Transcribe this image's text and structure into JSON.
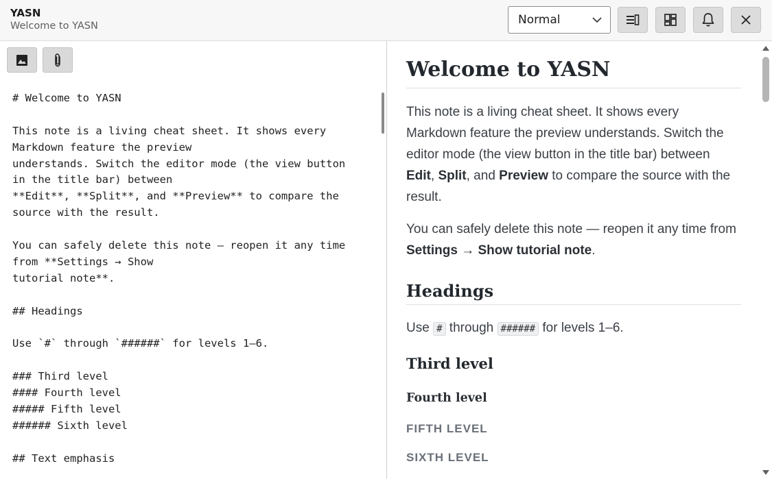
{
  "titlebar": {
    "title": "YASN",
    "subtitle": "Welcome to YASN",
    "mode_select": {
      "value": "Normal"
    },
    "buttons": [
      {
        "icon": "view-split-icon"
      },
      {
        "icon": "layout-grid-icon"
      },
      {
        "icon": "bell-icon"
      },
      {
        "icon": "close-icon"
      }
    ]
  },
  "editor": {
    "toolbar": [
      {
        "icon": "image-icon"
      },
      {
        "icon": "paperclip-icon"
      }
    ],
    "lines": [
      "# Welcome to YASN",
      "",
      "This note is a living cheat sheet. It shows every",
      "Markdown feature the preview",
      "understands. Switch the editor mode (the view button",
      "in the title bar) between",
      "**Edit**, **Split**, and **Preview** to compare the",
      "source with the result.",
      "",
      "You can safely delete this note — reopen it any time",
      "from **Settings → Show",
      "tutorial note**.",
      "",
      "## Headings",
      "",
      "Use `#` through `######` for levels 1–6.",
      "",
      "### Third level",
      "#### Fourth level",
      "##### Fifth level",
      "###### Sixth level",
      "",
      "## Text emphasis"
    ]
  },
  "preview": {
    "h1": "Welcome to YASN",
    "p1": {
      "before": "This note is a living cheat sheet. It shows every Markdown feature the preview understands. Switch the editor mode (the view button in the title bar) between ",
      "edit": "Edit",
      "comma": ", ",
      "split": "Split",
      "and": ", and ",
      "preview": "Preview",
      "after": " to compare the source with the result."
    },
    "p2": {
      "before": "You can safely delete this note — reopen it any time from ",
      "settings": "Settings → Show tutorial note",
      "after": "."
    },
    "h2_headings": "Headings",
    "p3": {
      "before": "Use ",
      "code1": "#",
      "mid": " through ",
      "code2": "######",
      "after": " for levels 1–6."
    },
    "h3": "Third level",
    "h4": "Fourth level",
    "h5": "Fifth level",
    "h6": "Sixth level"
  },
  "colors": {
    "titlebar_bg": "#f7f7f7",
    "button_bg": "#dcdcdc",
    "heading": "#23282e",
    "body_text": "#3a3f45",
    "muted_heading": "#6a7078"
  }
}
